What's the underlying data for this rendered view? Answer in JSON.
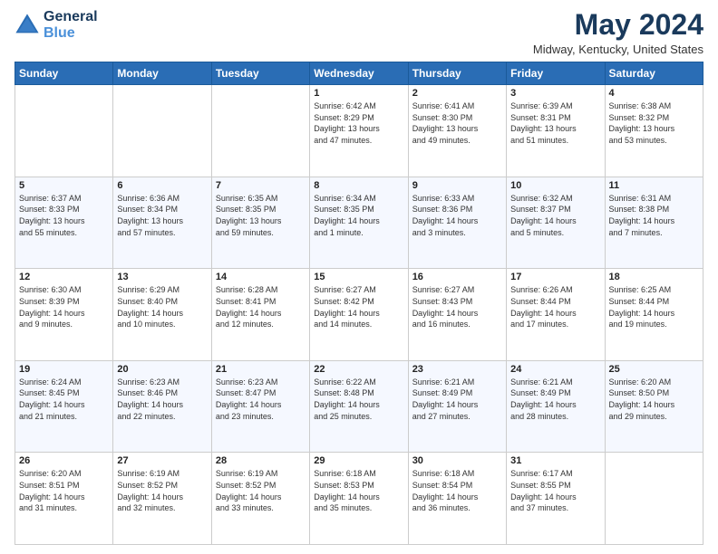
{
  "header": {
    "logo_line1": "General",
    "logo_line2": "Blue",
    "month_title": "May 2024",
    "location": "Midway, Kentucky, United States"
  },
  "days_of_week": [
    "Sunday",
    "Monday",
    "Tuesday",
    "Wednesday",
    "Thursday",
    "Friday",
    "Saturday"
  ],
  "weeks": [
    [
      {
        "day": "",
        "info": ""
      },
      {
        "day": "",
        "info": ""
      },
      {
        "day": "",
        "info": ""
      },
      {
        "day": "1",
        "info": "Sunrise: 6:42 AM\nSunset: 8:29 PM\nDaylight: 13 hours\nand 47 minutes."
      },
      {
        "day": "2",
        "info": "Sunrise: 6:41 AM\nSunset: 8:30 PM\nDaylight: 13 hours\nand 49 minutes."
      },
      {
        "day": "3",
        "info": "Sunrise: 6:39 AM\nSunset: 8:31 PM\nDaylight: 13 hours\nand 51 minutes."
      },
      {
        "day": "4",
        "info": "Sunrise: 6:38 AM\nSunset: 8:32 PM\nDaylight: 13 hours\nand 53 minutes."
      }
    ],
    [
      {
        "day": "5",
        "info": "Sunrise: 6:37 AM\nSunset: 8:33 PM\nDaylight: 13 hours\nand 55 minutes."
      },
      {
        "day": "6",
        "info": "Sunrise: 6:36 AM\nSunset: 8:34 PM\nDaylight: 13 hours\nand 57 minutes."
      },
      {
        "day": "7",
        "info": "Sunrise: 6:35 AM\nSunset: 8:35 PM\nDaylight: 13 hours\nand 59 minutes."
      },
      {
        "day": "8",
        "info": "Sunrise: 6:34 AM\nSunset: 8:35 PM\nDaylight: 14 hours\nand 1 minute."
      },
      {
        "day": "9",
        "info": "Sunrise: 6:33 AM\nSunset: 8:36 PM\nDaylight: 14 hours\nand 3 minutes."
      },
      {
        "day": "10",
        "info": "Sunrise: 6:32 AM\nSunset: 8:37 PM\nDaylight: 14 hours\nand 5 minutes."
      },
      {
        "day": "11",
        "info": "Sunrise: 6:31 AM\nSunset: 8:38 PM\nDaylight: 14 hours\nand 7 minutes."
      }
    ],
    [
      {
        "day": "12",
        "info": "Sunrise: 6:30 AM\nSunset: 8:39 PM\nDaylight: 14 hours\nand 9 minutes."
      },
      {
        "day": "13",
        "info": "Sunrise: 6:29 AM\nSunset: 8:40 PM\nDaylight: 14 hours\nand 10 minutes."
      },
      {
        "day": "14",
        "info": "Sunrise: 6:28 AM\nSunset: 8:41 PM\nDaylight: 14 hours\nand 12 minutes."
      },
      {
        "day": "15",
        "info": "Sunrise: 6:27 AM\nSunset: 8:42 PM\nDaylight: 14 hours\nand 14 minutes."
      },
      {
        "day": "16",
        "info": "Sunrise: 6:27 AM\nSunset: 8:43 PM\nDaylight: 14 hours\nand 16 minutes."
      },
      {
        "day": "17",
        "info": "Sunrise: 6:26 AM\nSunset: 8:44 PM\nDaylight: 14 hours\nand 17 minutes."
      },
      {
        "day": "18",
        "info": "Sunrise: 6:25 AM\nSunset: 8:44 PM\nDaylight: 14 hours\nand 19 minutes."
      }
    ],
    [
      {
        "day": "19",
        "info": "Sunrise: 6:24 AM\nSunset: 8:45 PM\nDaylight: 14 hours\nand 21 minutes."
      },
      {
        "day": "20",
        "info": "Sunrise: 6:23 AM\nSunset: 8:46 PM\nDaylight: 14 hours\nand 22 minutes."
      },
      {
        "day": "21",
        "info": "Sunrise: 6:23 AM\nSunset: 8:47 PM\nDaylight: 14 hours\nand 23 minutes."
      },
      {
        "day": "22",
        "info": "Sunrise: 6:22 AM\nSunset: 8:48 PM\nDaylight: 14 hours\nand 25 minutes."
      },
      {
        "day": "23",
        "info": "Sunrise: 6:21 AM\nSunset: 8:49 PM\nDaylight: 14 hours\nand 27 minutes."
      },
      {
        "day": "24",
        "info": "Sunrise: 6:21 AM\nSunset: 8:49 PM\nDaylight: 14 hours\nand 28 minutes."
      },
      {
        "day": "25",
        "info": "Sunrise: 6:20 AM\nSunset: 8:50 PM\nDaylight: 14 hours\nand 29 minutes."
      }
    ],
    [
      {
        "day": "26",
        "info": "Sunrise: 6:20 AM\nSunset: 8:51 PM\nDaylight: 14 hours\nand 31 minutes."
      },
      {
        "day": "27",
        "info": "Sunrise: 6:19 AM\nSunset: 8:52 PM\nDaylight: 14 hours\nand 32 minutes."
      },
      {
        "day": "28",
        "info": "Sunrise: 6:19 AM\nSunset: 8:52 PM\nDaylight: 14 hours\nand 33 minutes."
      },
      {
        "day": "29",
        "info": "Sunrise: 6:18 AM\nSunset: 8:53 PM\nDaylight: 14 hours\nand 35 minutes."
      },
      {
        "day": "30",
        "info": "Sunrise: 6:18 AM\nSunset: 8:54 PM\nDaylight: 14 hours\nand 36 minutes."
      },
      {
        "day": "31",
        "info": "Sunrise: 6:17 AM\nSunset: 8:55 PM\nDaylight: 14 hours\nand 37 minutes."
      },
      {
        "day": "",
        "info": ""
      }
    ]
  ]
}
